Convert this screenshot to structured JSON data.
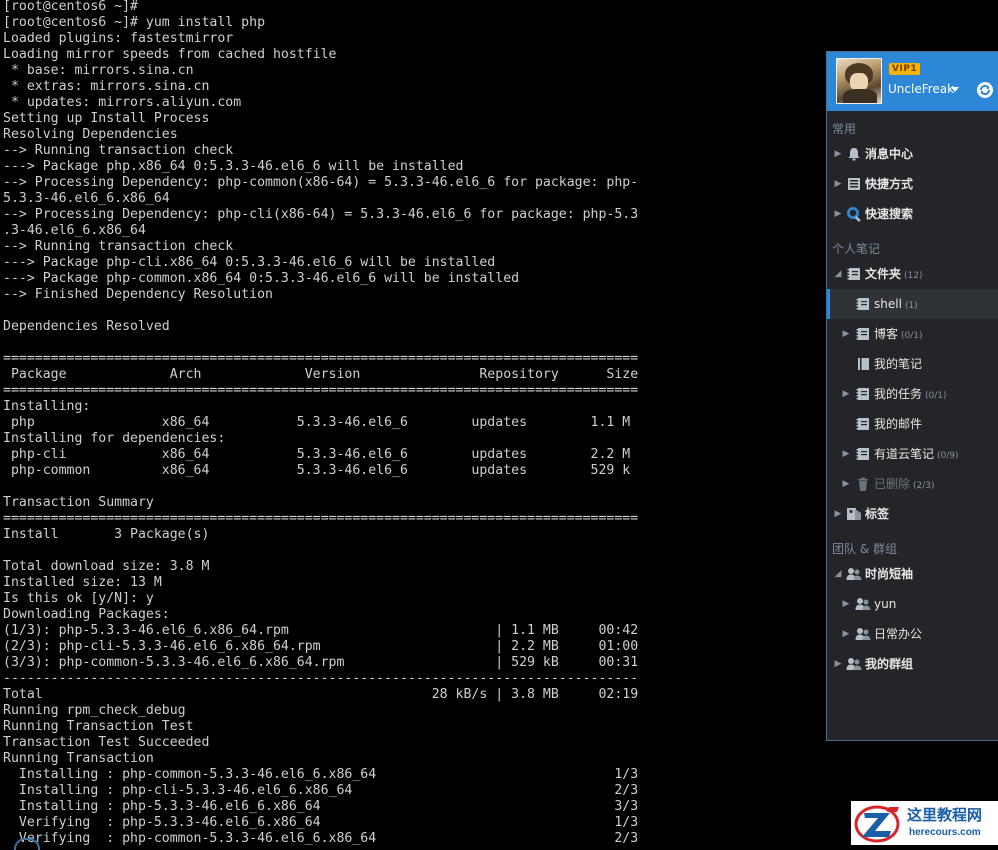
{
  "terminal": {
    "lines": [
      "[root@centos6 ~]#",
      "[root@centos6 ~]# yum install php",
      "Loaded plugins: fastestmirror",
      "Loading mirror speeds from cached hostfile",
      " * base: mirrors.sina.cn",
      " * extras: mirrors.sina.cn",
      " * updates: mirrors.aliyun.com",
      "Setting up Install Process",
      "Resolving Dependencies",
      "--> Running transaction check",
      "---> Package php.x86_64 0:5.3.3-46.el6_6 will be installed",
      "--> Processing Dependency: php-common(x86-64) = 5.3.3-46.el6_6 for package: php-",
      "5.3.3-46.el6_6.x86_64",
      "--> Processing Dependency: php-cli(x86-64) = 5.3.3-46.el6_6 for package: php-5.3",
      ".3-46.el6_6.x86_64",
      "--> Running transaction check",
      "---> Package php-cli.x86_64 0:5.3.3-46.el6_6 will be installed",
      "---> Package php-common.x86_64 0:5.3.3-46.el6_6 will be installed",
      "--> Finished Dependency Resolution",
      "",
      "Dependencies Resolved",
      "",
      "================================================================================",
      " Package             Arch             Version               Repository      Size",
      "================================================================================",
      "Installing:",
      " php                x86_64           5.3.3-46.el6_6        updates        1.1 M",
      "Installing for dependencies:",
      " php-cli            x86_64           5.3.3-46.el6_6        updates        2.2 M",
      " php-common         x86_64           5.3.3-46.el6_6        updates        529 k",
      "",
      "Transaction Summary",
      "================================================================================",
      "Install       3 Package(s)",
      "",
      "Total download size: 3.8 M",
      "Installed size: 13 M",
      "Is this ok [y/N]: y",
      "Downloading Packages:",
      "(1/3): php-5.3.3-46.el6_6.x86_64.rpm                          | 1.1 MB     00:42",
      "(2/3): php-cli-5.3.3-46.el6_6.x86_64.rpm                      | 2.2 MB     01:00",
      "(3/3): php-common-5.3.3-46.el6_6.x86_64.rpm                   | 529 kB     00:31",
      "--------------------------------------------------------------------------------",
      "Total                                                 28 kB/s | 3.8 MB     02:19",
      "Running rpm_check_debug",
      "Running Transaction Test",
      "Transaction Test Succeeded",
      "Running Transaction",
      "  Installing : php-common-5.3.3-46.el6_6.x86_64                              1/3",
      "  Installing : php-cli-5.3.3-46.el6_6.x86_64                                 2/3",
      "  Installing : php-5.3.3-46.el6_6.x86_64                                     3/3",
      "  Verifying  : php-5.3.3-46.el6_6.x86_64                                     1/3",
      "  Verifying  : php-common-5.3.3-46.el6_6.x86_64                              2/3"
    ]
  },
  "sidebar": {
    "profile": {
      "vip": "VIP1",
      "username": "UncleFreak"
    },
    "sections": {
      "common": "常用",
      "personal": "个人笔记",
      "team": "团队 & 群组"
    },
    "items": {
      "messages": {
        "label": "消息中心"
      },
      "shortcuts": {
        "label": "快捷方式"
      },
      "quick_search": {
        "label": "快速搜索"
      },
      "folders": {
        "label": "文件夹",
        "count": "(12)"
      },
      "shell": {
        "label": "shell",
        "count": "(1)"
      },
      "blog": {
        "label": "博客",
        "count": "(0/1)"
      },
      "my_notes": {
        "label": "我的笔记"
      },
      "my_tasks": {
        "label": "我的任务",
        "count": "(0/1)"
      },
      "my_mail": {
        "label": "我的邮件"
      },
      "youdao_notes": {
        "label": "有道云笔记",
        "count": "(0/9)"
      },
      "deleted": {
        "label": "已删除",
        "count": "(2/3)"
      },
      "tags": {
        "label": "标签"
      },
      "fashion_shorts": {
        "label": "时尚短袖"
      },
      "yun": {
        "label": "yun"
      },
      "daily_office": {
        "label": "日常办公"
      },
      "my_groups": {
        "label": "我的群组"
      }
    }
  },
  "watermark": {
    "cn": "这里教程网",
    "en": "herecours.com"
  },
  "colors": {
    "terminal_bg": "#000000",
    "terminal_fg": "#cfcfcf",
    "sidebar_bg": "#232528",
    "accent": "#2d87d6",
    "vip": "#f4b400"
  }
}
